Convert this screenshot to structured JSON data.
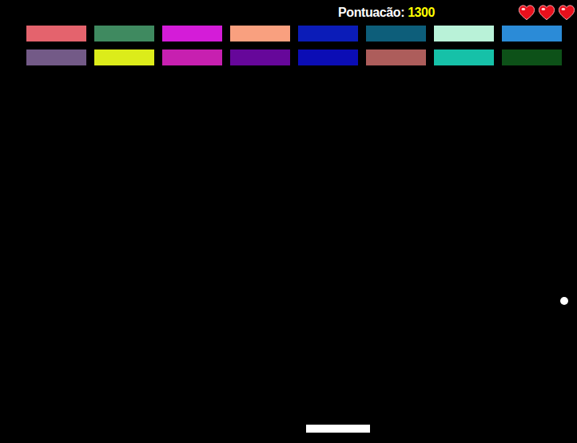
{
  "hud": {
    "score_label": "Pontuacão:",
    "score": "1300"
  },
  "lives": [
    {
      "filled": true
    },
    {
      "filled": true
    },
    {
      "filled": true
    }
  ],
  "brick_rows": [
    {
      "bricks": [
        {
          "color": "#e4636d"
        },
        {
          "color": "#3f8a60"
        },
        {
          "color": "#d41cd8"
        },
        {
          "color": "#f9a07f"
        },
        {
          "color": "#0b1cb8"
        },
        {
          "color": "#0d5e7a"
        },
        {
          "color": "#b9f2d8"
        },
        {
          "color": "#2b8bd7"
        }
      ]
    },
    {
      "bricks": [
        {
          "color": "#735a87"
        },
        {
          "color": "#dcec1a"
        },
        {
          "color": "#c720b0"
        },
        {
          "color": "#66079a"
        },
        {
          "color": "#0b0db5"
        },
        {
          "color": "#ad5d5b"
        },
        {
          "color": "#16c1a8"
        },
        {
          "color": "#0d5118"
        }
      ]
    }
  ]
}
